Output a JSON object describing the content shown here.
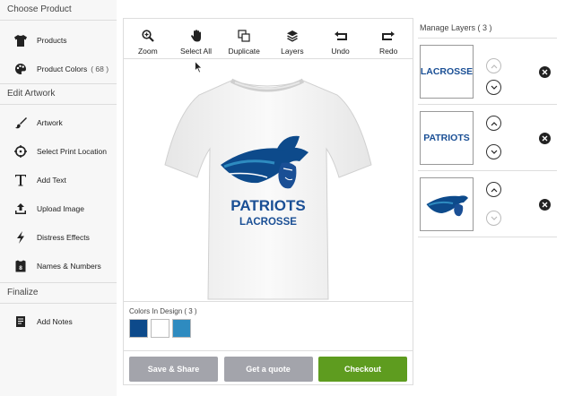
{
  "left_panel": {
    "choose_product": {
      "title": "Choose Product",
      "items": [
        {
          "label": "Products",
          "icon": "tshirt-icon"
        },
        {
          "label": "Product Colors",
          "count": "( 68 )",
          "icon": "palette-icon"
        }
      ]
    },
    "edit_artwork": {
      "title": "Edit Artwork",
      "items": [
        {
          "label": "Artwork",
          "icon": "brush-icon"
        },
        {
          "label": "Select Print Location",
          "icon": "crosshair-icon"
        },
        {
          "label": "Add Text",
          "icon": "text-icon"
        },
        {
          "label": "Upload Image",
          "icon": "upload-icon"
        },
        {
          "label": "Distress Effects",
          "icon": "lightning-icon"
        },
        {
          "label": "Names & Numbers",
          "icon": "jersey-icon"
        }
      ]
    },
    "finalize": {
      "title": "Finalize",
      "items": [
        {
          "label": "Add Notes",
          "icon": "notes-icon"
        }
      ]
    }
  },
  "toolbar": {
    "zoom": "Zoom",
    "select_all": "Select All",
    "duplicate": "Duplicate",
    "layers": "Layers",
    "undo": "Undo",
    "redo": "Redo"
  },
  "design": {
    "line1": "PATRIOTS",
    "line2": "LACROSSE",
    "text_color": "#1a4f95",
    "shirt_color": "#f7f7f7"
  },
  "colors_in_design": {
    "label": "Colors In Design ( 3 )",
    "swatches": [
      "#0d4a8b",
      "#ffffff",
      "#2e8bc0"
    ]
  },
  "actions": {
    "save_share": "Save & Share",
    "get_quote": "Get a quote",
    "checkout": "Checkout"
  },
  "layers_panel": {
    "title": "Manage Layers ( 3 )",
    "layers": [
      {
        "thumb_text": "LACROSSE"
      },
      {
        "thumb_text": "PATRIOTS"
      },
      {
        "thumb_text": ""
      }
    ]
  }
}
